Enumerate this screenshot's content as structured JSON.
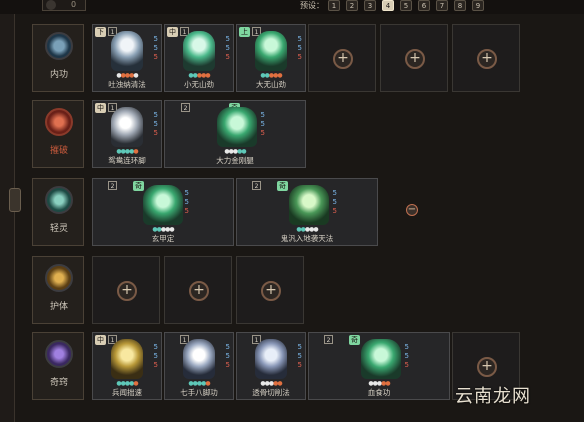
{
  "topbar": {
    "count": "0",
    "preset_label": "预设：",
    "presets": [
      "1",
      "2",
      "3",
      "4",
      "5",
      "6",
      "7",
      "8",
      "9"
    ],
    "active_preset": "4"
  },
  "categories": [
    {
      "label": "内功",
      "icon": "neigong-icon",
      "color": "#3a6a8a"
    },
    {
      "label": "摧破",
      "icon": "cuipo-icon",
      "color": "#a83c30"
    },
    {
      "label": "轻灵",
      "icon": "qingling-icon",
      "color": "#3a8a80"
    },
    {
      "label": "护体",
      "icon": "huti-icon",
      "color": "#b88a2c"
    },
    {
      "label": "奇窍",
      "icon": "qiqiao-icon",
      "color": "#6a4aa0"
    }
  ],
  "skills": {
    "neigong": [
      {
        "name": "吐浊纳清法",
        "badge": "下",
        "lv": "1",
        "s1": "5",
        "s2": "5",
        "s3": "5"
      },
      {
        "name": "小无山劲",
        "badge": "中",
        "lv": "1",
        "s1": "5",
        "s2": "5",
        "s3": "5"
      },
      {
        "name": "大无山劲",
        "badge": "上",
        "lv": "1",
        "s1": "5",
        "s2": "5",
        "s3": "5"
      }
    ],
    "cuipo": [
      {
        "name": "鸳鸯连环脚",
        "badge": "中",
        "lv": "1",
        "s1": "5",
        "s2": "5",
        "s3": "5"
      },
      {
        "name": "大力金刚腿",
        "badge": "奇",
        "lv": "2",
        "s1": "5",
        "s2": "5",
        "s3": "5"
      }
    ],
    "qingling": [
      {
        "name": "玄甲定",
        "badge": "奇",
        "lv": "2",
        "s1": "5",
        "s2": "5",
        "s3": "5"
      },
      {
        "name": "鬼汎入地袭天法",
        "badge": "奇",
        "lv": "2",
        "s1": "5",
        "s2": "5",
        "s3": "5"
      }
    ],
    "qiqiao": [
      {
        "name": "兵闻拙速",
        "badge": "中",
        "lv": "1",
        "s1": "5",
        "s2": "5",
        "s3": "5"
      },
      {
        "name": "七手八脚功",
        "badge": "",
        "lv": "1",
        "s1": "5",
        "s2": "5",
        "s3": "5"
      },
      {
        "name": "透骨切削法",
        "badge": "",
        "lv": "1",
        "s1": "5",
        "s2": "5",
        "s3": "5"
      },
      {
        "name": "血食功",
        "badge": "奇",
        "lv": "2",
        "s1": "5",
        "s2": "5",
        "s3": "5"
      }
    ]
  },
  "empty_slot_symbol": "+",
  "remove_symbol": "−",
  "watermark": "云南龙网"
}
